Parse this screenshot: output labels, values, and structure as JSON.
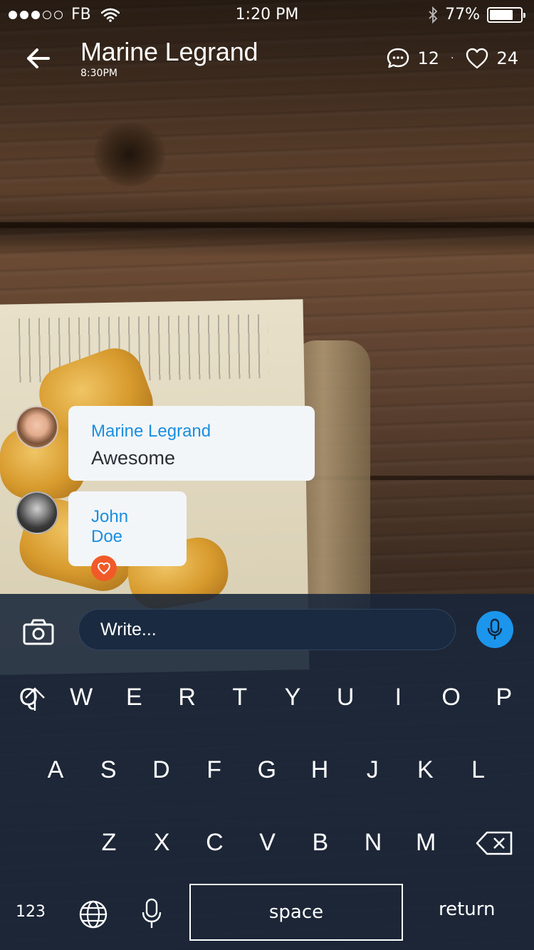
{
  "status_bar": {
    "carrier": "FB",
    "time": "1:20 PM",
    "battery": "77%",
    "battery_level": 0.77
  },
  "header": {
    "title": "Marine Legrand",
    "subtitle": "8:30PM",
    "comments_count": "12",
    "separator": "·",
    "likes_count": "24"
  },
  "messages": [
    {
      "name": "Marine Legrand",
      "text": "Awesome"
    },
    {
      "name": "John Doe",
      "reaction": "heart-icon"
    }
  ],
  "composer": {
    "placeholder": "Write..."
  },
  "keyboard": {
    "row1": [
      "Q",
      "W",
      "E",
      "R",
      "T",
      "Y",
      "U",
      "I",
      "O",
      "P"
    ],
    "row2": [
      "A",
      "S",
      "D",
      "F",
      "G",
      "H",
      "J",
      "K",
      "L"
    ],
    "row3": [
      "Z",
      "X",
      "C",
      "V",
      "B",
      "N",
      "M"
    ],
    "numbers_label": "123",
    "space_label": "space",
    "return_label": "return"
  },
  "colors": {
    "accent": "#1a8ee0",
    "mic": "#1c95ec",
    "heart": "#f15a28"
  }
}
